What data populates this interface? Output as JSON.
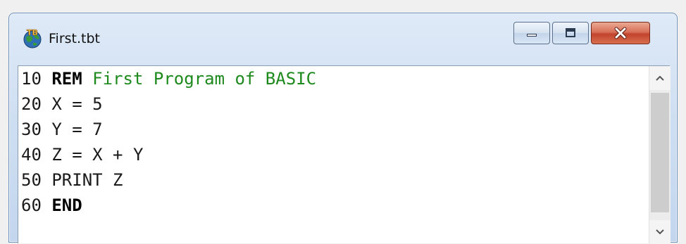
{
  "window": {
    "title": "First.tbt",
    "app_icon": "tb-globe-icon",
    "icon_label": "TB"
  },
  "title_controls": {
    "minimize": "minimize-icon",
    "maximize": "maximize-icon",
    "close": "close-icon"
  },
  "editor": {
    "lines": [
      {
        "number": "10",
        "keyword": "REM",
        "rest": "",
        "comment": "First Program of BASIC"
      },
      {
        "number": "20",
        "keyword": "",
        "rest": "X = 5",
        "comment": ""
      },
      {
        "number": "30",
        "keyword": "",
        "rest": "Y = 7",
        "comment": ""
      },
      {
        "number": "40",
        "keyword": "",
        "rest": "Z = X + Y",
        "comment": ""
      },
      {
        "number": "50",
        "keyword": "",
        "rest": "PRINT Z",
        "comment": ""
      },
      {
        "number": "60",
        "keyword": "END",
        "rest": "",
        "comment": ""
      }
    ]
  },
  "scrollbar": {
    "up": "chevron-up-icon",
    "down": "chevron-down-icon"
  },
  "colors": {
    "comment": "#1e8a1e",
    "close_button": "#c2442c",
    "title_gradient": "#cfdff2"
  }
}
